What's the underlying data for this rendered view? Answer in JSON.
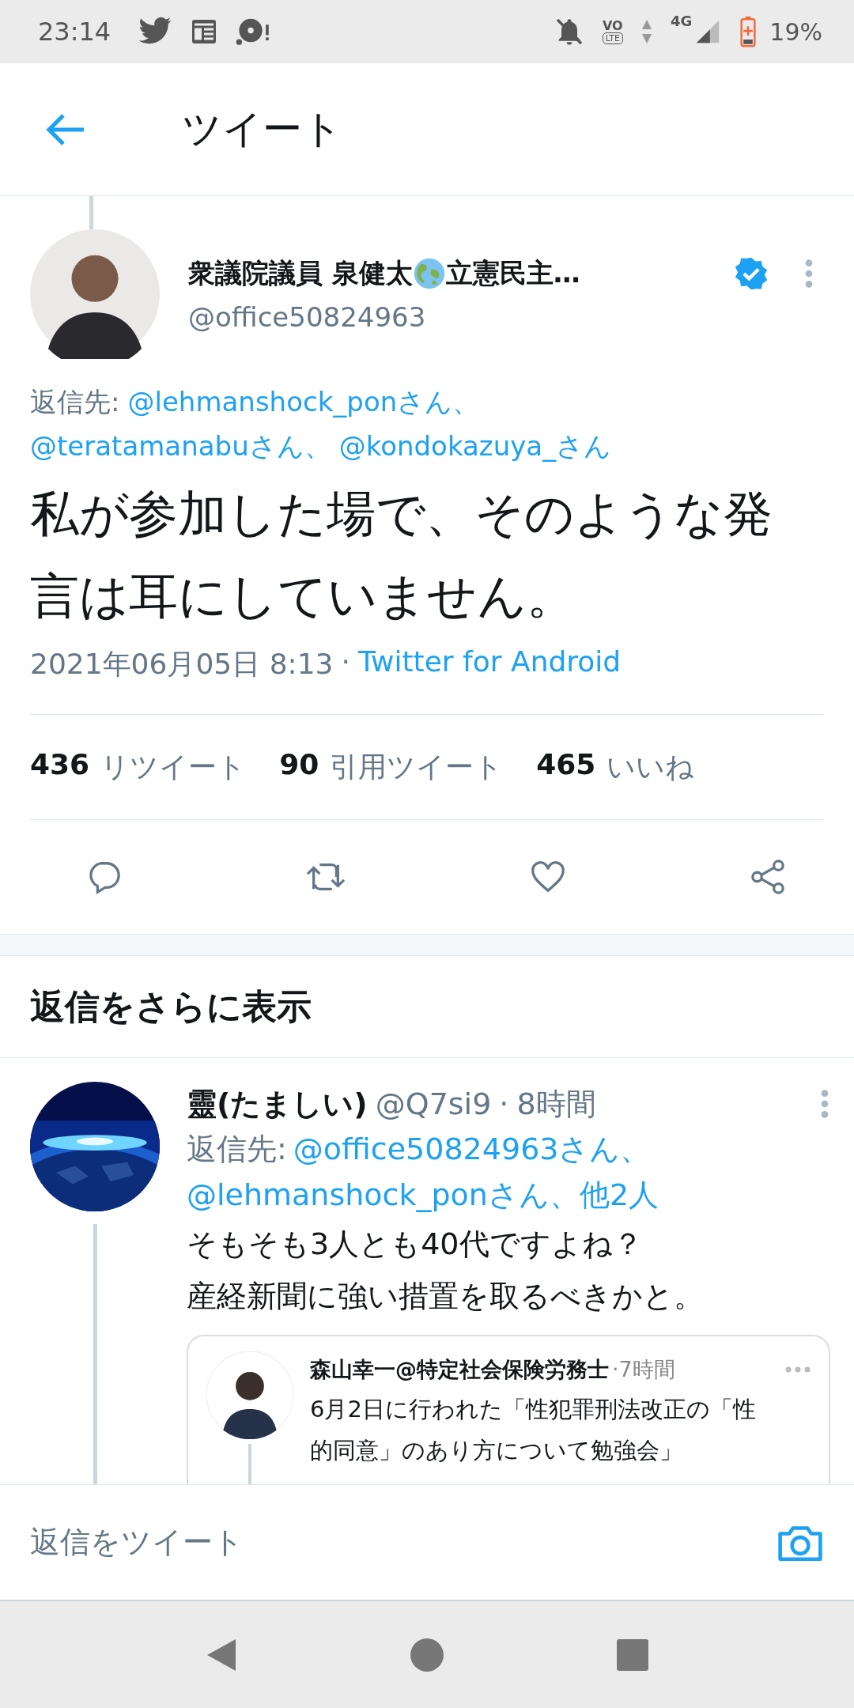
{
  "status_bar": {
    "time": "23:14",
    "volte": [
      "VO",
      "LTE"
    ],
    "network": "4G",
    "battery": "19%"
  },
  "header": {
    "title": "ツイート"
  },
  "tweet": {
    "name_parts": [
      "衆議院議員 泉健太",
      "立憲民主…"
    ],
    "verified": true,
    "handle": "@office50824963",
    "reply_to_label": "返信先:",
    "reply_to_lines": [
      [
        "@lehmanshock_ponさん、"
      ],
      [
        "@teratamanabuさん、",
        "@kondokazuya_さん"
      ]
    ],
    "text_lines": [
      "私が参加した場で、そのような発",
      "言は耳にしていません。"
    ],
    "date": "2021年06月05日 8:13",
    "separator": "·",
    "source": "Twitter for Android",
    "stats": [
      {
        "count": "436",
        "label": "リツイート"
      },
      {
        "count": "90",
        "label": "引用ツイート"
      },
      {
        "count": "465",
        "label": "いいね"
      }
    ]
  },
  "more_replies": "返信をさらに表示",
  "reply": {
    "name": "靈(たましい)",
    "handle": "@Q7si9",
    "separator": "·",
    "time": "8時間",
    "reply_to_label": "返信先:",
    "reply_to_lines": [
      [
        "@office50824963さん、"
      ],
      [
        "@lehmanshock_ponさん、他2人"
      ]
    ],
    "text_lines": [
      "そもそも3人とも40代ですよね？",
      "産経新聞に強い措置を取るべきかと。"
    ],
    "quote": {
      "name": "森山幸一@特定社会保険労務士",
      "time": "·7時間",
      "text_lines": [
        "6月2日に行われた「性犯罪刑法改正の「性",
        "的同意」のあり方について勉強会」"
      ]
    }
  },
  "composer": {
    "placeholder": "返信をツイート"
  }
}
